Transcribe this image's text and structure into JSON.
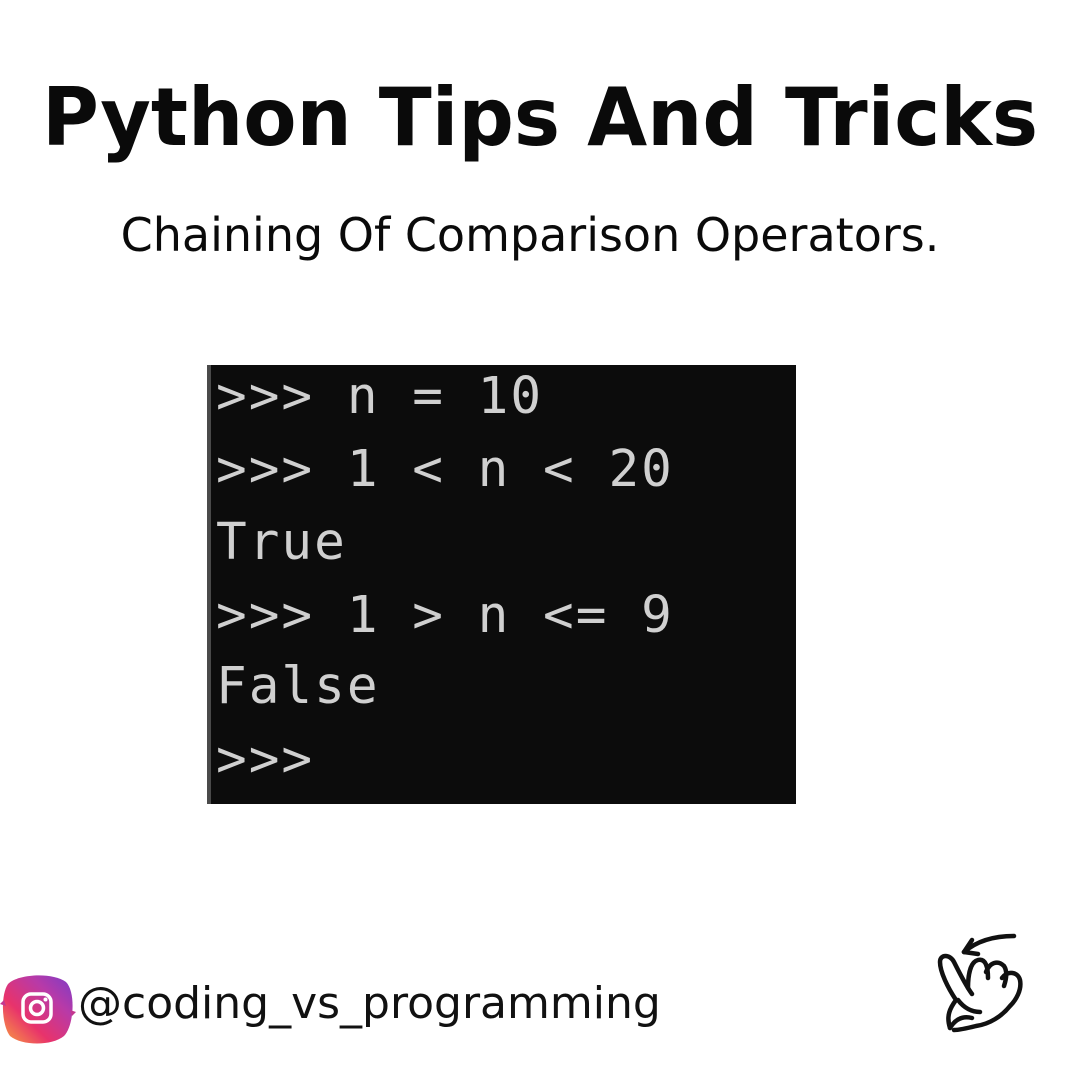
{
  "header": {
    "title": "Python Tips And Tricks",
    "subtitle": "Chaining Of Comparison Operators."
  },
  "terminal": {
    "lines": [
      ">>> n = 10",
      ">>> 1 < n < 20",
      "True",
      ">>> 1 > n <= 9",
      "False",
      ">>>"
    ],
    "background": "#0c0c0c",
    "text_color": "#d0d0d0"
  },
  "footer": {
    "handle": "@coding_vs_programming",
    "social_icon": "instagram-icon",
    "swipe_icon": "swipe-hand-icon"
  }
}
